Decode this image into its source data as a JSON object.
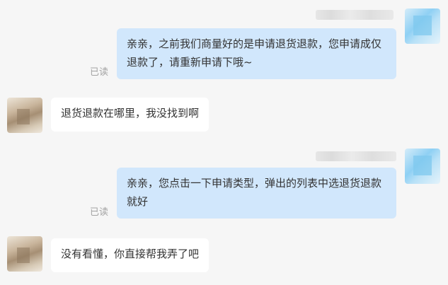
{
  "messages": [
    {
      "direction": "outgoing",
      "sender": "agent",
      "text": "亲亲，之前我们商量好的是申请退货退款，您申请成仅退款了，请重新申请下哦~",
      "read_status": "已读"
    },
    {
      "direction": "incoming",
      "sender": "customer",
      "text": "退货退款在哪里，我没找到啊"
    },
    {
      "direction": "outgoing",
      "sender": "agent",
      "text": "亲亲，您点击一下申请类型，弹出的列表中选退货退款就好",
      "read_status": "已读"
    },
    {
      "direction": "incoming",
      "sender": "customer",
      "text": "没有看懂，你直接帮我弄了吧"
    }
  ],
  "colors": {
    "page_background": "#f6f6f6",
    "outgoing_bubble": "#d1e7fc",
    "incoming_bubble": "#ffffff",
    "message_text": "#333333",
    "read_status_text": "#a3a3a3"
  },
  "icons": {
    "agent_avatar": "blurred-avatar",
    "customer_avatar": "blurred-avatar"
  }
}
